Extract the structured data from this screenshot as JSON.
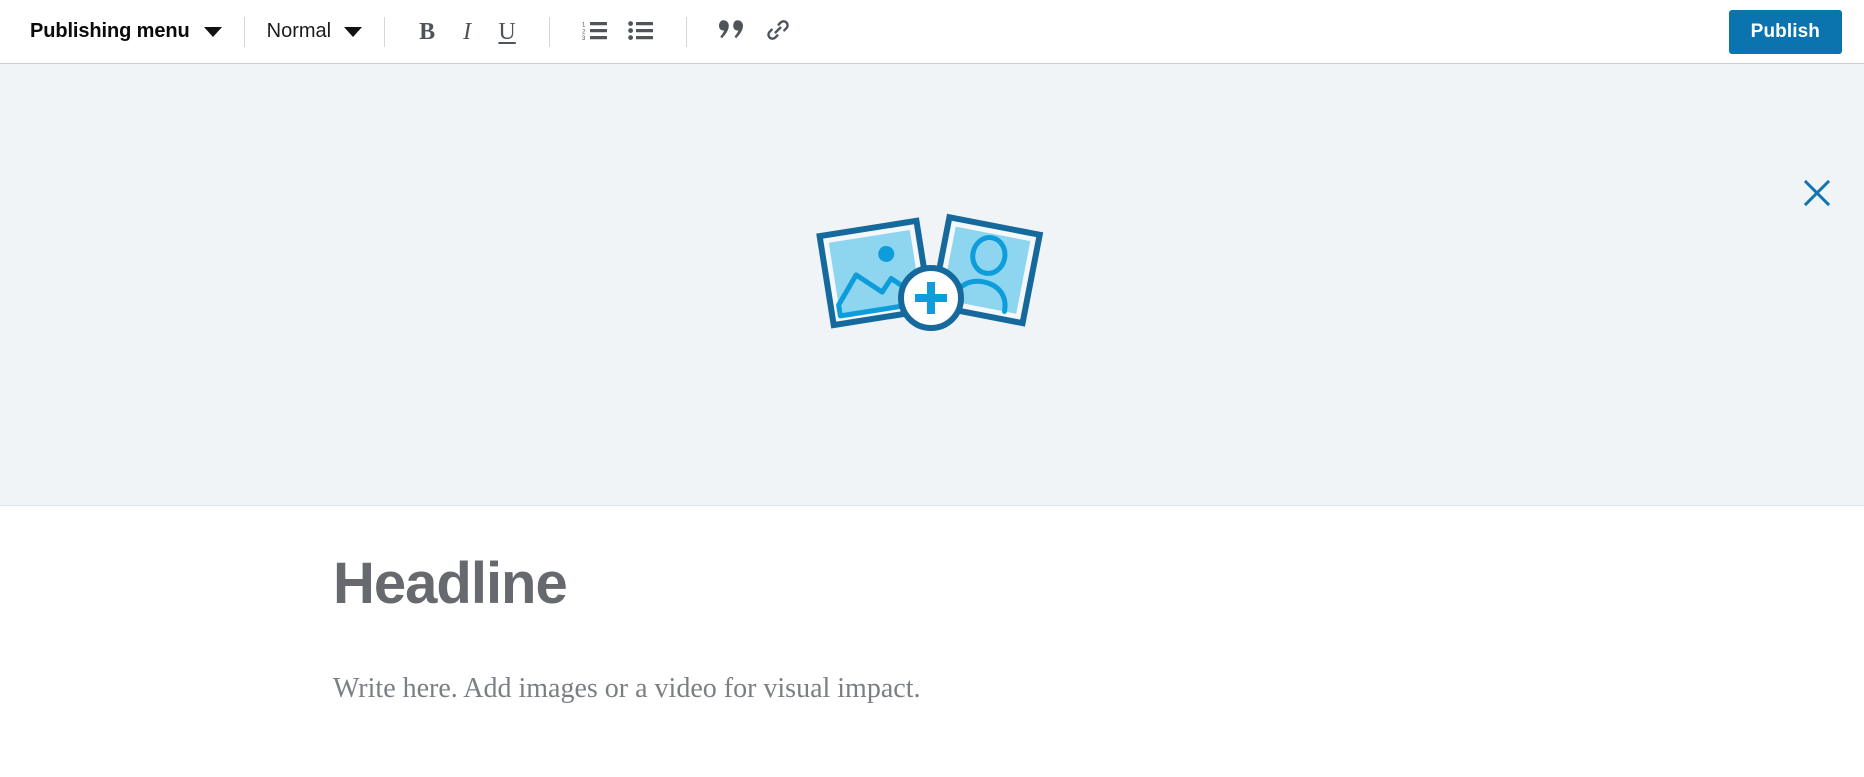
{
  "toolbar": {
    "publishing_menu_label": "Publishing menu",
    "publishing_menu_icon": "chevron-down-icon",
    "style_select_value": "Normal",
    "style_select_icon": "chevron-down-icon",
    "format_buttons": [
      {
        "name": "bold",
        "glyph": "B",
        "title": "Bold"
      },
      {
        "name": "italic",
        "glyph": "I",
        "title": "Italic"
      },
      {
        "name": "underline",
        "glyph": "U",
        "title": "Underline"
      }
    ],
    "list_buttons": [
      {
        "name": "ordered-list-icon",
        "title": "Numbered list"
      },
      {
        "name": "unordered-list-icon",
        "title": "Bulleted list"
      }
    ],
    "insert_buttons": [
      {
        "name": "quote-icon",
        "title": "Quote"
      },
      {
        "name": "link-icon",
        "title": "Link"
      }
    ],
    "publish_label": "Publish",
    "publish_color": "#0b73ad"
  },
  "hero": {
    "close_icon": "close-icon",
    "close_color": "#1176b0",
    "placeholder_icon": "add-photos-icon",
    "background_color": "#f1f4f7",
    "icon_colors": {
      "frame_outline": "#15699c",
      "photo_fill": "#8ed5f0",
      "accent": "#0d9ddb",
      "frame_inner": "#f4f8fa"
    }
  },
  "article": {
    "headline_placeholder": "Headline",
    "body_placeholder": "Write here. Add images or a video for visual impact.",
    "headline_color": "#66696d",
    "body_color": "#7b7f84"
  }
}
